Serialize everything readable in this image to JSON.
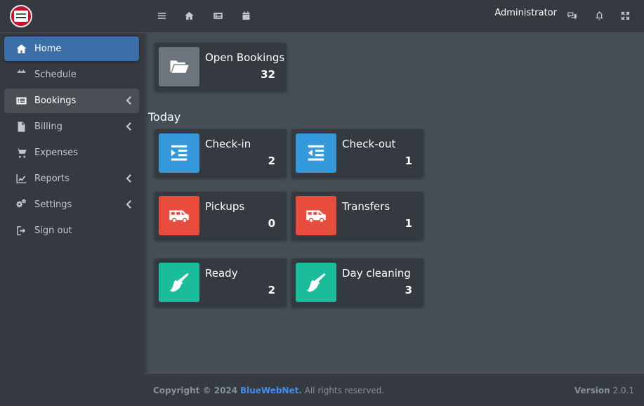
{
  "sidebar": {
    "logo_icon": "hotel-logo-icon",
    "items": [
      {
        "label": "Home",
        "icon": "home-icon",
        "state": "active",
        "has_submenu": false
      },
      {
        "label": "Schedule",
        "icon": "calendar-icon",
        "state": "normal",
        "has_submenu": false
      },
      {
        "label": "Bookings",
        "icon": "list-card-icon",
        "state": "open",
        "has_submenu": true
      },
      {
        "label": "Billing",
        "icon": "file-invoice-icon",
        "state": "normal",
        "has_submenu": true
      },
      {
        "label": "Expenses",
        "icon": "cart-icon",
        "state": "normal",
        "has_submenu": false
      },
      {
        "label": "Reports",
        "icon": "chart-line-icon",
        "state": "normal",
        "has_submenu": true
      },
      {
        "label": "Settings",
        "icon": "cogs-icon",
        "state": "normal",
        "has_submenu": true
      },
      {
        "label": "Sign out",
        "icon": "sign-out-icon",
        "state": "normal",
        "has_submenu": false
      }
    ]
  },
  "topbar": {
    "icons": [
      "menu-icon",
      "home-icon",
      "list-card-icon",
      "calendar-icon"
    ],
    "user_name": "Administrator",
    "right_icons": [
      "chat-icon",
      "bell-icon",
      "fullscreen-icon"
    ]
  },
  "dashboard": {
    "open_bookings": {
      "title": "Open Bookings",
      "value": "32",
      "icon": "folder-open-icon",
      "color": "#6c757d"
    },
    "today_label": "Today",
    "today": [
      {
        "title": "Check-in",
        "value": "2",
        "icon": "indent-icon",
        "color": "#3498db"
      },
      {
        "title": "Check-out",
        "value": "1",
        "icon": "outdent-icon",
        "color": "#3498db"
      },
      {
        "title": "Pickups",
        "value": "0",
        "icon": "shuttle-van-icon",
        "color": "#e74c3c"
      },
      {
        "title": "Transfers",
        "value": "1",
        "icon": "shuttle-van-icon",
        "color": "#e74c3c"
      },
      {
        "title": "Ready",
        "value": "2",
        "icon": "broom-icon",
        "color": "#1abc9c"
      },
      {
        "title": "Day cleaning",
        "value": "3",
        "icon": "broom-icon",
        "color": "#1abc9c"
      }
    ]
  },
  "footer": {
    "copyright_prefix": "Copyright © 2024",
    "brand": "BlueWebNet.",
    "suffix": "All rights reserved.",
    "version_label": "Version",
    "version_value": "2.0.1"
  },
  "colors": {
    "sidebar_bg": "#343a40",
    "content_bg": "#454d55",
    "active_nav": "#3c6ea8",
    "brand_link": "#3f8ef0"
  }
}
